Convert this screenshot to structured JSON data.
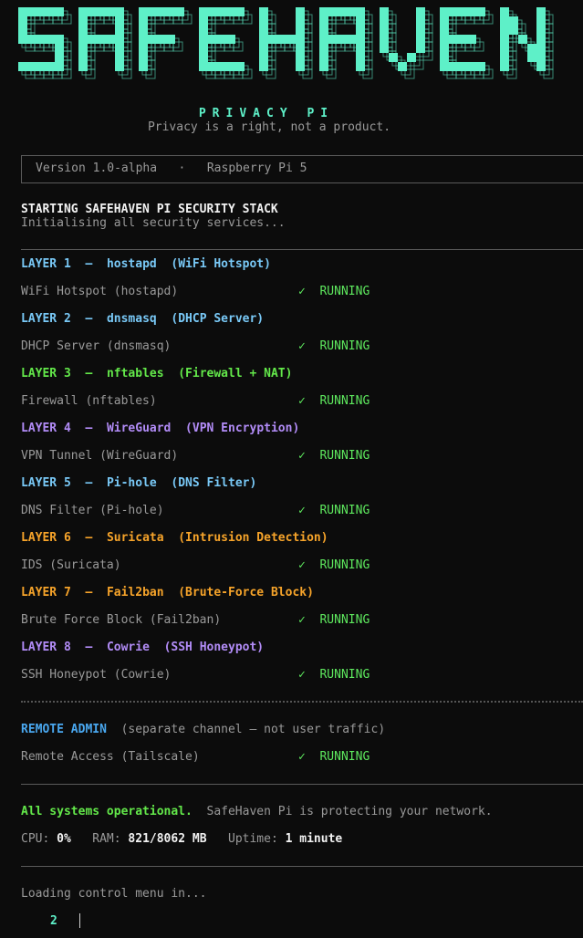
{
  "banner": {
    "title": "SAFEHAVEN",
    "subtitle": "PRIVACY PI",
    "tagline": "Privacy is a right, not a product."
  },
  "version_bar": {
    "version": "Version 1.0-alpha",
    "separator": "·",
    "platform": "Raspberry Pi 5"
  },
  "startup": {
    "heading": "STARTING SAFEHAVEN PI SECURITY STACK",
    "sub": "Initialising all security services..."
  },
  "status_text": "✓  RUNNING",
  "layers": [
    {
      "layer": "LAYER 1",
      "dash": "–",
      "tool": "hostapd",
      "desc": "(WiFi Hotspot)",
      "color": "#79c9f7",
      "service": "WiFi Hotspot (hostapd)"
    },
    {
      "layer": "LAYER 2",
      "dash": "–",
      "tool": "dnsmasq",
      "desc": "(DHCP Server)",
      "color": "#79c9f7",
      "service": "DHCP Server (dnsmasq)"
    },
    {
      "layer": "LAYER 3",
      "dash": "–",
      "tool": "nftables",
      "desc": "(Firewall + NAT)",
      "color": "#63e84a",
      "service": "Firewall (nftables)"
    },
    {
      "layer": "LAYER 4",
      "dash": "–",
      "tool": "WireGuard",
      "desc": "(VPN Encryption)",
      "color": "#b28cf7",
      "service": "VPN Tunnel (WireGuard)"
    },
    {
      "layer": "LAYER 5",
      "dash": "–",
      "tool": "Pi-hole",
      "desc": "(DNS Filter)",
      "color": "#79c9f7",
      "service": "DNS Filter (Pi-hole)"
    },
    {
      "layer": "LAYER 6",
      "dash": "–",
      "tool": "Suricata",
      "desc": "(Intrusion Detection)",
      "color": "#f7a42a",
      "service": "IDS (Suricata)"
    },
    {
      "layer": "LAYER 7",
      "dash": "–",
      "tool": "Fail2ban",
      "desc": "(Brute-Force Block)",
      "color": "#f7a42a",
      "service": "Brute Force Block (Fail2ban)"
    },
    {
      "layer": "LAYER 8",
      "dash": "–",
      "tool": "Cowrie",
      "desc": "(SSH Honeypot)",
      "color": "#b28cf7",
      "service": "SSH Honeypot (Cowrie)"
    }
  ],
  "remote": {
    "label": "REMOTE ADMIN",
    "note": "(separate channel — not user traffic)",
    "service": "Remote Access (Tailscale)"
  },
  "summary": {
    "ok": "All systems operational.",
    "message": "SafeHaven Pi is protecting your network.",
    "cpu_label": "CPU:",
    "cpu_value": "0%",
    "ram_label": "RAM:",
    "ram_value": "821/8062 MB",
    "uptime_label": "Uptime:",
    "uptime_value": "1 minute"
  },
  "loading": {
    "text": "Loading control menu in...",
    "countdown": "2"
  },
  "colors": {
    "banner": "#5ef0c8",
    "running": "#5ee85e",
    "remote": "#4aa8f0"
  }
}
